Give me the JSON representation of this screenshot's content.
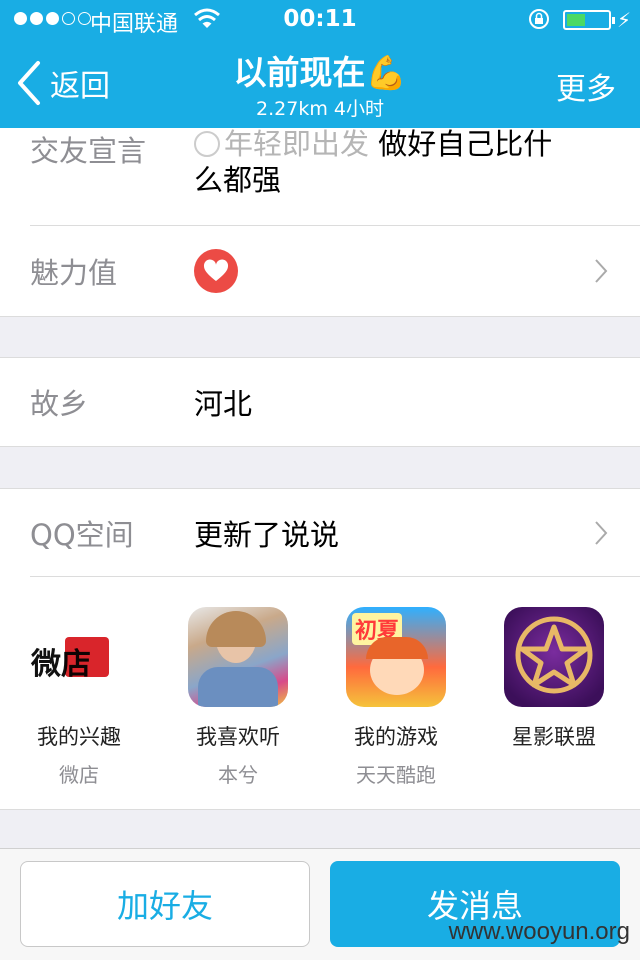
{
  "status_bar": {
    "carrier": "中国联通",
    "time": "00:11"
  },
  "nav": {
    "back_label": "返回",
    "title": "以前现在💪",
    "subtitle": "2.27km 4小时",
    "more_label": "更多"
  },
  "profile": {
    "declaration_label": "交友宣言",
    "declaration_prefix": "年轻即出发",
    "declaration_text": "做好自己比什么都强",
    "charm_label": "魅力值",
    "hometown_label": "故乡",
    "hometown_value": "河北",
    "qzone_label": "QQ空间",
    "qzone_value": "更新了说说"
  },
  "apps": [
    {
      "name": "我的兴趣",
      "sub": "微店",
      "icon_text": "微店"
    },
    {
      "name": "我喜欢听",
      "sub": "本兮"
    },
    {
      "name": "我的游戏",
      "sub": "天天酷跑",
      "icon_text": "初夏"
    },
    {
      "name": "星影联盟",
      "sub": ""
    }
  ],
  "actions": {
    "add_friend": "加好友",
    "send_message": "发消息"
  },
  "watermark": "www.wooyun.org",
  "colors": {
    "accent": "#19ade4",
    "heart": "#ec4b45"
  }
}
